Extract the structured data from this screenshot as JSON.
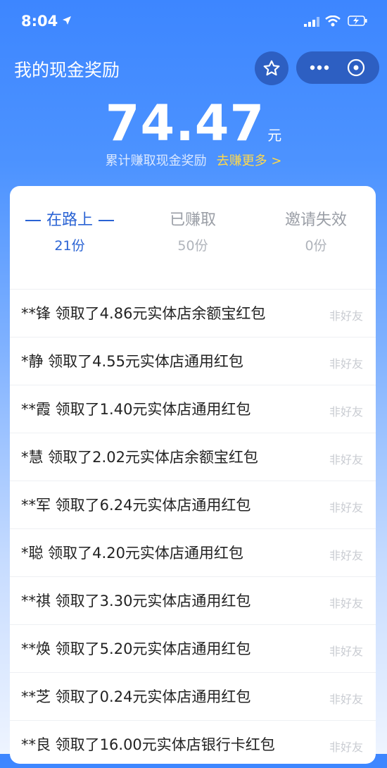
{
  "status_bar": {
    "time": "8:04"
  },
  "header": {
    "title": "我的现金奖励"
  },
  "reward": {
    "amount": "74.47",
    "unit": "元",
    "label": "累计赚取现金奖励",
    "link": "去赚更多 >"
  },
  "tabs": [
    {
      "label": "在路上",
      "count": "21份"
    },
    {
      "label": "已赚取",
      "count": "50份"
    },
    {
      "label": "邀请失效",
      "count": "0份"
    }
  ],
  "records": [
    {
      "text": "**锋 领取了4.86元实体店余额宝红包",
      "tag": "非好友"
    },
    {
      "text": "*静 领取了4.55元实体店通用红包",
      "tag": "非好友"
    },
    {
      "text": "**霞 领取了1.40元实体店通用红包",
      "tag": "非好友"
    },
    {
      "text": "*慧 领取了2.02元实体店余额宝红包",
      "tag": "非好友"
    },
    {
      "text": "**军 领取了6.24元实体店通用红包",
      "tag": "非好友"
    },
    {
      "text": "*聪 领取了4.20元实体店通用红包",
      "tag": "非好友"
    },
    {
      "text": "**祺 领取了3.30元实体店通用红包",
      "tag": "非好友"
    },
    {
      "text": "**焕 领取了5.20元实体店通用红包",
      "tag": "非好友"
    },
    {
      "text": "**芝 领取了0.24元实体店通用红包",
      "tag": "非好友"
    },
    {
      "text": "**良 领取了16.00元实体店银行卡红包",
      "tag": "非好友"
    }
  ],
  "icons": {
    "location": "location-arrow-icon",
    "signal": "signal-bars-icon",
    "wifi": "wifi-icon",
    "battery": "battery-charging-icon",
    "favorite": "star-outline-icon",
    "more": "more-dots-icon",
    "close": "close-circle-icon"
  },
  "colors": {
    "accent": "#2a63d4",
    "link": "#ffd84a",
    "header_bg": "#3d86ff"
  }
}
